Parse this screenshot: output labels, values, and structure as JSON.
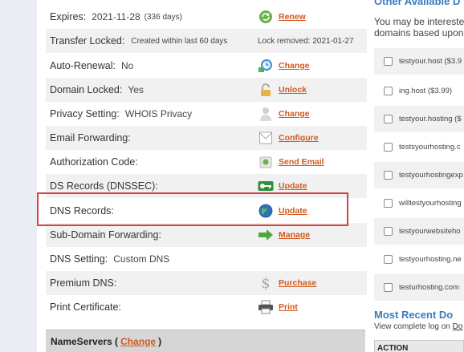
{
  "domain_details": {
    "rows": [
      {
        "label": "Expires:",
        "value": "2021-11-28",
        "note": "(336 days)",
        "action": "Renew",
        "icon": "renew-icon"
      },
      {
        "label": "Transfer Locked:",
        "note": "Created within last 60 days",
        "right_note": "Lock removed: 2021-01-27"
      },
      {
        "label": "Auto-Renewal:",
        "value": "No",
        "action": "Change",
        "icon": "clock-icon"
      },
      {
        "label": "Domain Locked:",
        "value": "Yes",
        "action": "Unlock",
        "icon": "lock-icon"
      },
      {
        "label": "Privacy Setting:",
        "value": "WHOIS Privacy",
        "action": "Change",
        "icon": "privacy-icon"
      },
      {
        "label": "Email Forwarding:",
        "action": "Configure",
        "icon": "envelope-icon"
      },
      {
        "label": "Authorization Code:",
        "action": "Send Email",
        "icon": "auth-code-icon"
      },
      {
        "label": "DS Records (DNSSEC):",
        "action": "Update",
        "icon": "key-icon"
      },
      {
        "label": "DNS Records:",
        "action": "Update",
        "icon": "globe-icon"
      },
      {
        "label": "Sub-Domain Forwarding:",
        "action": "Manage",
        "icon": "arrow-right-icon"
      },
      {
        "label": "DNS Setting:",
        "value": "Custom DNS"
      },
      {
        "label": "Premium DNS:",
        "action": "Purchase",
        "icon": "dollar-icon"
      },
      {
        "label": "Print Certificate:",
        "action": "Print",
        "icon": "printer-icon"
      }
    ],
    "nameservers": {
      "prefix": "NameServers (",
      "link": "Change",
      "suffix": ")"
    }
  },
  "sidebar": {
    "heading": "Other Available D",
    "intro_line1": "You may be intereste",
    "intro_line2": "domains based upon",
    "suggestions": [
      "testyour.host ($3.9",
      "ing.host ($3.99)",
      "testyour.hosting ($",
      "testsyourhosting.c",
      "testyourhostingexp",
      "willtestyourhosting",
      "testyourwebsiteho",
      "testyourhosting.ne",
      "testurhosting.com"
    ],
    "recent_heading": "Most Recent Do",
    "log_prefix": "View complete log on ",
    "log_link": "Do",
    "action_header": "ACTION"
  },
  "colors": {
    "link": "#d05a1f",
    "accent": "#3a7bbf",
    "highlight": "#d8413f"
  }
}
